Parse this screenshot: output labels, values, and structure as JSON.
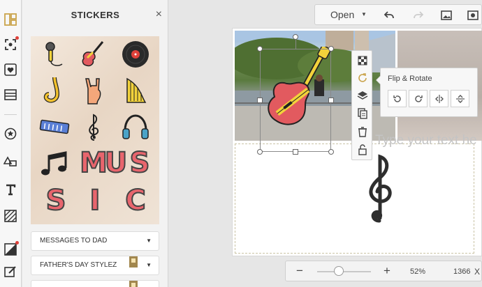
{
  "panel": {
    "title": "STICKERS",
    "close_label": "×",
    "letters_row1": [
      "M",
      "U",
      "S"
    ],
    "letters_row2": [
      "S",
      "I",
      "C"
    ],
    "dropdowns": [
      "MESSAGES TO DAD",
      "FATHER'S DAY STYLEZ",
      ""
    ]
  },
  "toolbar": {
    "open_label": "Open"
  },
  "canvas": {
    "text_placeholder": "Type your text he"
  },
  "flip_rotate": {
    "title": "Flip & Rotate"
  },
  "zoom": {
    "minus": "−",
    "plus": "+",
    "percent": "52%",
    "width": "1366",
    "x": "X",
    "level": 0.52
  },
  "colors": {
    "accent_red": "#e0413a",
    "brand_yellow": "#a2874e",
    "guitar_red": "#e25a5f",
    "guitar_yellow": "#f2d23b"
  },
  "icons": {
    "rail": [
      "layout-icon",
      "background-icon",
      "sticker-heart-icon",
      "table-icon",
      "badge-star-icon",
      "shapes-icon",
      "text-icon",
      "pattern-icon",
      "color-icon",
      "edit-icon"
    ],
    "vstrip": [
      "transparency-icon",
      "rotate-icon",
      "layers-icon",
      "duplicate-icon",
      "trash-icon",
      "lock-icon"
    ],
    "flip": [
      "rotate-left-icon",
      "rotate-right-icon",
      "flip-horizontal-icon",
      "flip-vertical-icon"
    ]
  }
}
